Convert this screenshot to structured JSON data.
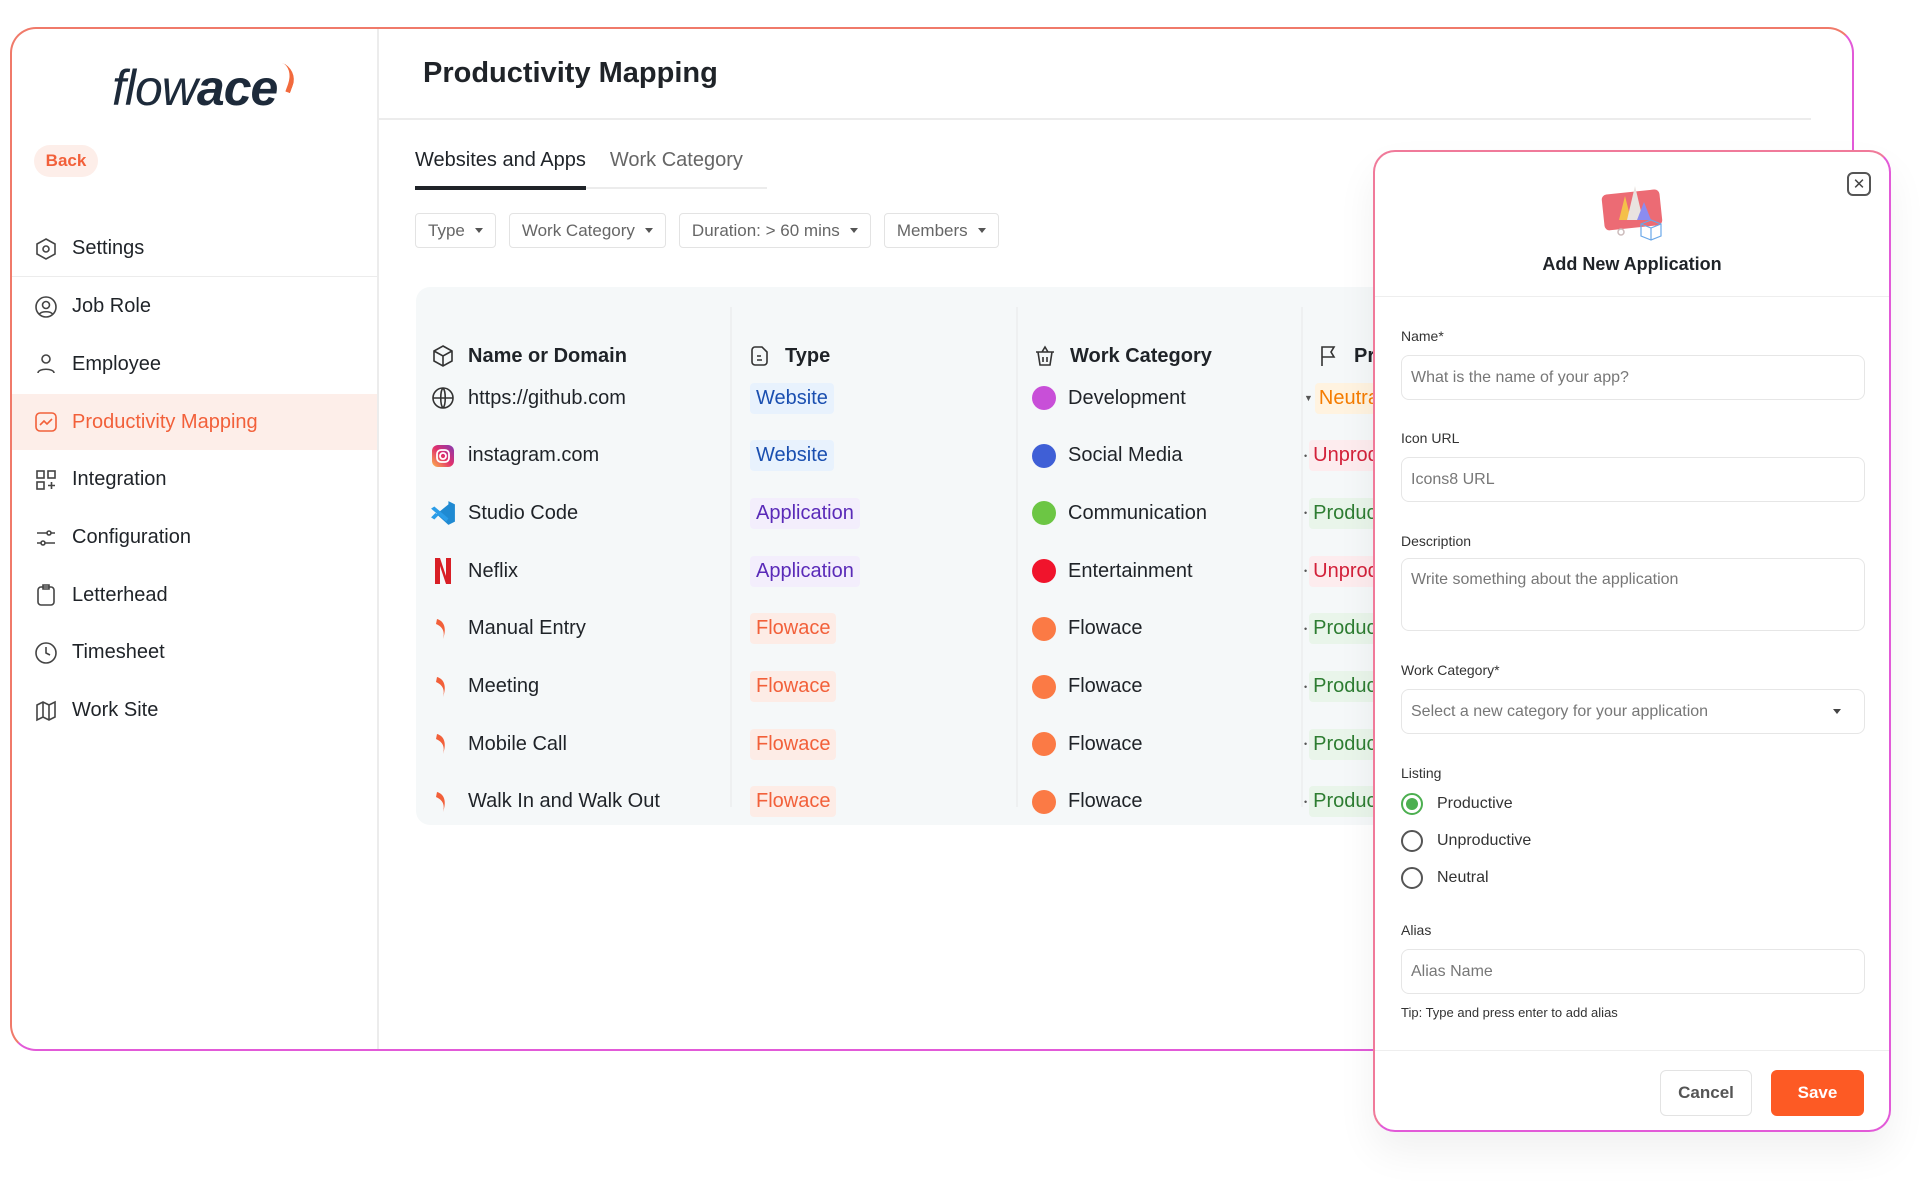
{
  "brand": {
    "logo_text_light": "flow",
    "logo_text_bold": "ace",
    "accent": "#f2603a"
  },
  "sidebar": {
    "back_label": "Back",
    "items": [
      {
        "label": "Settings",
        "icon": "hexagon-gear-icon"
      },
      {
        "label": "Job Role",
        "icon": "user-circle-icon"
      },
      {
        "label": "Employee",
        "icon": "user-icon"
      },
      {
        "label": "Productivity Mapping",
        "icon": "chart-icon",
        "active": true
      },
      {
        "label": "Integration",
        "icon": "grid-plus-icon"
      },
      {
        "label": "Configuration",
        "icon": "sliders-icon"
      },
      {
        "label": "Letterhead",
        "icon": "clipboard-icon"
      },
      {
        "label": "Timesheet",
        "icon": "clock-icon"
      },
      {
        "label": "Work Site",
        "icon": "map-icon"
      }
    ]
  },
  "main": {
    "title": "Productivity Mapping",
    "tabs": [
      {
        "label": "Websites and Apps",
        "active": true
      },
      {
        "label": "Work Category"
      }
    ],
    "filters": [
      "Type",
      "Work Category",
      "Duration: > 60 mins",
      "Members"
    ],
    "table": {
      "headers": [
        "Name or Domain",
        "Type",
        "Work Category",
        "Prod"
      ],
      "rows": [
        {
          "name": "https://github.com",
          "icon": "globe-icon",
          "type": "Website",
          "category": "Development",
          "cat_color": "#c84fd8",
          "prod": "Neutral"
        },
        {
          "name": "instagram.com",
          "icon": "instagram-icon",
          "type": "Website",
          "category": "Social Media",
          "cat_color": "#3f5fd6",
          "prod": "Unprod"
        },
        {
          "name": "Studio Code",
          "icon": "vscode-icon",
          "type": "Application",
          "category": "Communication",
          "cat_color": "#6cc644",
          "prod": "Produc"
        },
        {
          "name": "Neflix",
          "icon": "netflix-icon",
          "type": "Application",
          "category": "Entertainment",
          "cat_color": "#f0142c",
          "prod": "Unprod"
        },
        {
          "name": "Manual Entry",
          "icon": "flowace-icon",
          "type": "Flowace",
          "category": "Flowace",
          "cat_color": "#fb7a45",
          "prod": "Produc"
        },
        {
          "name": "Meeting",
          "icon": "flowace-icon",
          "type": "Flowace",
          "category": "Flowace",
          "cat_color": "#fb7a45",
          "prod": "Produc"
        },
        {
          "name": "Mobile Call",
          "icon": "flowace-icon",
          "type": "Flowace",
          "category": "Flowace",
          "cat_color": "#fb7a45",
          "prod": "Produc"
        },
        {
          "name": "Walk In and Walk Out",
          "icon": "flowace-icon",
          "type": "Flowace",
          "category": "Flowace",
          "cat_color": "#fb7a45",
          "prod": "Produc"
        }
      ]
    }
  },
  "panel": {
    "title": "Add New Application",
    "name_label": "Name*",
    "name_placeholder": "What is the name of your app?",
    "icon_label": "Icon URL",
    "icon_placeholder": "Icons8 URL",
    "desc_label": "Description",
    "desc_placeholder": "Write something about the application",
    "cat_label": "Work Category*",
    "cat_placeholder": "Select a new category for your application",
    "listing_label": "Listing",
    "listing_options": [
      "Productive",
      "Unproductive",
      "Neutral"
    ],
    "listing_selected": "Productive",
    "alias_label": "Alias",
    "alias_placeholder": "Alias Name",
    "alias_tip": "Tip: Type and press enter to add alias",
    "cancel": "Cancel",
    "save": "Save"
  }
}
